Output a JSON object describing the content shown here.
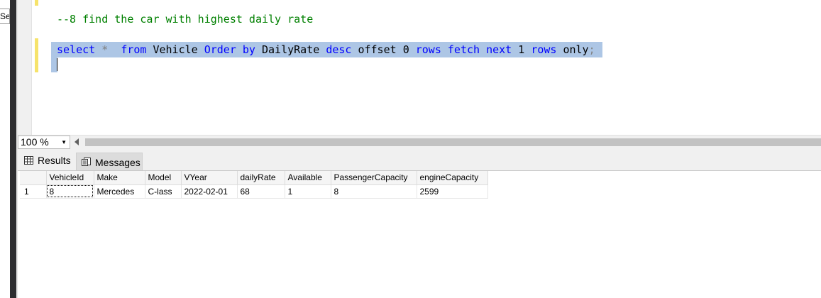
{
  "left_panel": {
    "label": "Se"
  },
  "editor": {
    "comment_line": "--8 find the car with highest daily rate",
    "query": {
      "select": "select",
      "star": "*",
      "from": "from",
      "table": "Vehicle",
      "order_by": "Order by",
      "column": "DailyRate",
      "desc": "desc",
      "offset": "offset",
      "offset_value": "0",
      "rows1": "rows",
      "fetch_next": "fetch next",
      "fetch_value": "1",
      "rows2": "rows",
      "only": "only",
      "semicolon": ";"
    }
  },
  "zoom": {
    "value": "100 %"
  },
  "tabs": {
    "results": "Results",
    "messages": "Messages"
  },
  "grid": {
    "columns": [
      "VehicleId",
      "Make",
      "Model",
      "VYear",
      "dailyRate",
      "Available",
      "PassengerCapacity",
      "engineCapacity"
    ],
    "rows": [
      {
        "num": "1",
        "cells": [
          "8",
          "Mercedes",
          "C-lass",
          "2022-02-01",
          "68",
          "1",
          "8",
          "2599"
        ]
      }
    ]
  },
  "colors": {
    "keyword": "#0000ff",
    "comment": "#008000",
    "selection": "#adc6e5",
    "change_marker": "#f6e36b"
  }
}
